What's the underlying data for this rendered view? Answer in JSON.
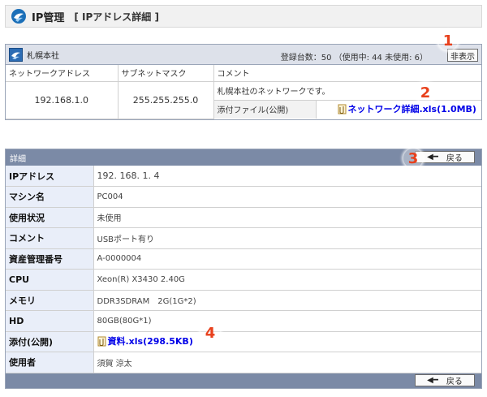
{
  "app": {
    "title": "IP管理",
    "subtitle": "[ IPアドレス詳細 ]"
  },
  "network": {
    "name": "札幌本社",
    "count_text": "登録台数：50 （使用中: 44 未使用: 6）",
    "hide_button": "非表示",
    "headers": {
      "address": "ネットワークアドレス",
      "mask": "サブネットマスク",
      "comment": "コメント"
    },
    "address": "192.168.1.0",
    "mask": "255.255.255.0",
    "comment": "札幌本社のネットワークです。",
    "attachment_label": "添付ファイル(公開)",
    "attachment_file": "ネットワーク詳細.xls(1.0MB)"
  },
  "detail": {
    "title": "詳細",
    "back_button": "戻る",
    "rows": [
      {
        "label": "IPアドレス",
        "value": "192. 168. 1. 4"
      },
      {
        "label": "マシン名",
        "value": "PC004"
      },
      {
        "label": "使用状況",
        "value": "未使用"
      },
      {
        "label": "コメント",
        "value": "USBポート有り"
      },
      {
        "label": "資産管理番号",
        "value": "A-0000004"
      },
      {
        "label": "CPU",
        "value": "Xeon(R) X3430 2.40G"
      },
      {
        "label": "メモリ",
        "value": "DDR3SDRAM　2G(1G*2)"
      },
      {
        "label": "HD",
        "value": "80GB(80G*1)"
      },
      {
        "label": "添付(公開)",
        "value": "資料.xls(298.5KB)"
      },
      {
        "label": "使用者",
        "value": "須賀 涼太"
      }
    ]
  },
  "markers": [
    "1",
    "2",
    "3",
    "4"
  ],
  "colors": {
    "header_bar": "#7b8aa6",
    "label_bg": "#e9eef9",
    "link": "#0000e8",
    "marker": "#e8401c"
  }
}
